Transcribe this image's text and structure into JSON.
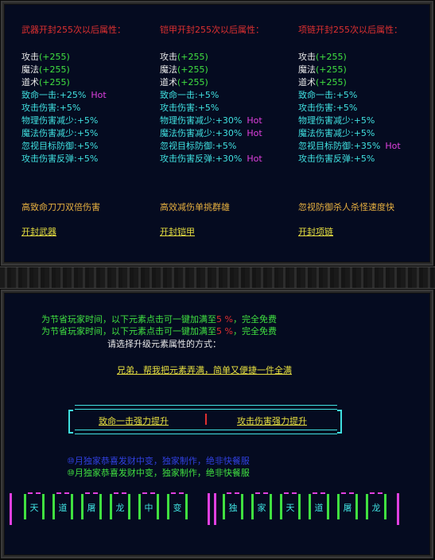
{
  "weapon": {
    "title": "武器开封255次以后属性：",
    "stats": [
      {
        "label": "攻击",
        "value": "(+255)",
        "hot": "",
        "color": "white"
      },
      {
        "label": "魔法",
        "value": "(+255)",
        "hot": "",
        "color": "white"
      },
      {
        "label": "道术",
        "value": "(+255)",
        "hot": "",
        "color": "white"
      },
      {
        "label": "致命一击:+25%",
        "value": "",
        "hot": "Hot",
        "color": "cyan"
      },
      {
        "label": "攻击伤害:+5%",
        "value": "",
        "hot": "",
        "color": "cyan"
      },
      {
        "label": "物理伤害减少:+5%",
        "value": "",
        "hot": "",
        "color": "cyan"
      },
      {
        "label": "魔法伤害减少:+5%",
        "value": "",
        "hot": "",
        "color": "cyan"
      },
      {
        "label": "忽视目标防御:+5%",
        "value": "",
        "hot": "",
        "color": "cyan"
      },
      {
        "label": "攻击伤害反弹:+5%",
        "value": "",
        "hot": "",
        "color": "cyan"
      }
    ],
    "desc": "高致命刀刀双倍伤害",
    "button": "开封武器"
  },
  "armor": {
    "title": "铠甲开封255次以后属性：",
    "stats": [
      {
        "label": "攻击",
        "value": "(+255)",
        "hot": "",
        "color": "white"
      },
      {
        "label": "魔法",
        "value": "(+255)",
        "hot": "",
        "color": "white"
      },
      {
        "label": "道术",
        "value": "(+255)",
        "hot": "",
        "color": "white"
      },
      {
        "label": "致命一击:+5%",
        "value": "",
        "hot": "",
        "color": "cyan"
      },
      {
        "label": "攻击伤害:+5%",
        "value": "",
        "hot": "",
        "color": "cyan"
      },
      {
        "label": "物理伤害减少:+30%",
        "value": "",
        "hot": "Hot",
        "color": "cyan"
      },
      {
        "label": "魔法伤害减少:+30%",
        "value": "",
        "hot": "Hot",
        "color": "cyan"
      },
      {
        "label": "忽视目标防御:+5%",
        "value": "",
        "hot": "",
        "color": "cyan"
      },
      {
        "label": "攻击伤害反弹:+30%",
        "value": "",
        "hot": "Hot",
        "color": "cyan"
      }
    ],
    "desc": "高效减伤单挑群雄",
    "button": "开封铠甲"
  },
  "necklace": {
    "title": "项链开封255次以后属性：",
    "stats": [
      {
        "label": "攻击",
        "value": "(+255)",
        "hot": "",
        "color": "white"
      },
      {
        "label": "魔法",
        "value": "(+255)",
        "hot": "",
        "color": "white"
      },
      {
        "label": "道术",
        "value": "(+255)",
        "hot": "",
        "color": "white"
      },
      {
        "label": "致命一击:+5%",
        "value": "",
        "hot": "",
        "color": "cyan"
      },
      {
        "label": "攻击伤害:+5%",
        "value": "",
        "hot": "",
        "color": "cyan"
      },
      {
        "label": "物理伤害减少:+5%",
        "value": "",
        "hot": "",
        "color": "cyan"
      },
      {
        "label": "魔法伤害减少:+5%",
        "value": "",
        "hot": "",
        "color": "cyan"
      },
      {
        "label": "忽视目标防御:+35%",
        "value": "",
        "hot": "Hot",
        "color": "cyan"
      },
      {
        "label": "攻击伤害反弹:+5%",
        "value": "",
        "hot": "",
        "color": "cyan"
      }
    ],
    "desc": "忽视防御杀人杀怪速度快",
    "button": "开封项链"
  },
  "notice": {
    "pre": "为节省玩家时间，以下元素点击可一键加满至",
    "pct": "5 %",
    "post": "，完全免费"
  },
  "prompt": "请选择升级元素属性的方式：",
  "quick_link": "兄弟，帮我把元素弄满，简单又便捷一件全满",
  "choices": {
    "left": "致命一击强力提升",
    "right": "攻击伤害强力提升"
  },
  "credits": {
    "line1": "⑩月独家恭喜发财中变，独家制作，绝非快餐服",
    "line2": "⑩月独家恭喜发财中变，独家制作，绝非快餐服"
  },
  "banner_left": [
    "天",
    "道",
    "屠",
    "龙",
    "中",
    "变"
  ],
  "banner_right": [
    "独",
    "家",
    "天",
    "道",
    "屠",
    "龙"
  ],
  "colors": {
    "panel_bg": "#050b20",
    "title_red": "#e03030",
    "cyan": "#40e0e0",
    "green": "#40e040",
    "yellow": "#e8e040",
    "magenta": "#e040e0",
    "orange": "#e8b040",
    "blue": "#3040e0"
  }
}
